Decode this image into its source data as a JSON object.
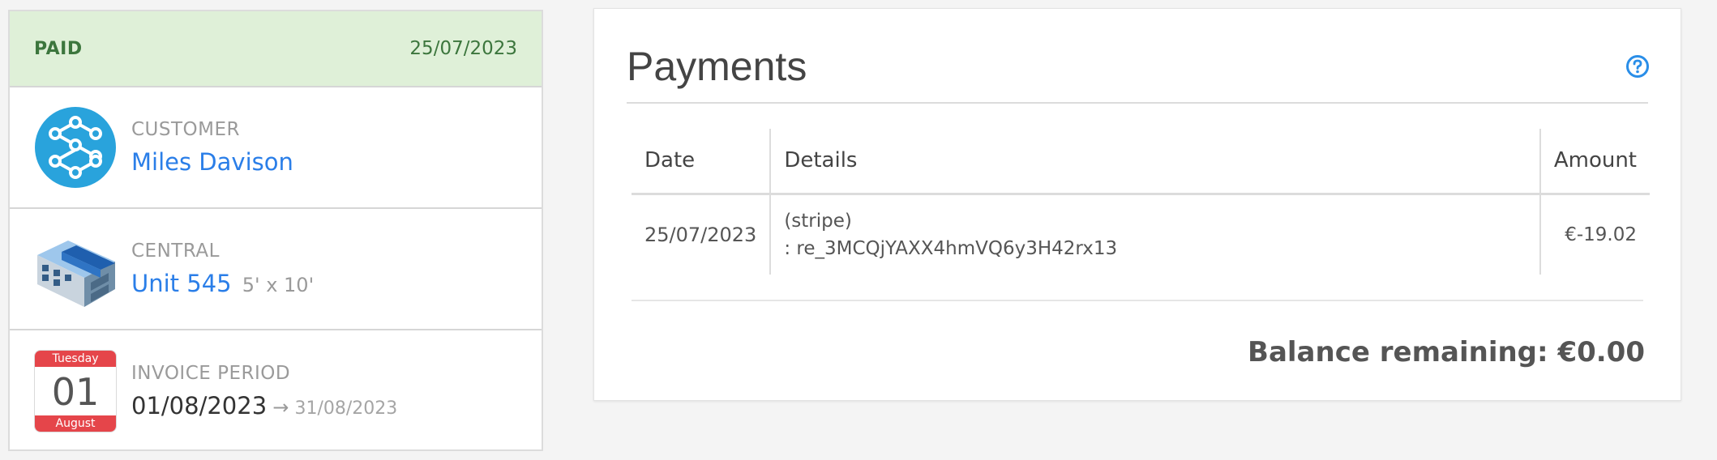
{
  "invoice": {
    "status": "PAID",
    "status_date": "25/07/2023",
    "customer": {
      "label": "CUSTOMER",
      "name": "Miles Davison",
      "icon": "customer-avatar-icon"
    },
    "site": {
      "label": "CENTRAL",
      "unit": "Unit 545",
      "size": "5' x 10'",
      "icon": "building-icon"
    },
    "period": {
      "label": "INVOICE PERIOD",
      "start": "01/08/2023",
      "arrow": "→",
      "end": "31/08/2023",
      "calendar": {
        "weekday": "Tuesday",
        "day": "01",
        "month": "August"
      }
    }
  },
  "payments": {
    "title": "Payments",
    "help_icon": "question-circle-icon",
    "columns": {
      "date": "Date",
      "details": "Details",
      "amount": "Amount"
    },
    "rows": [
      {
        "date": "25/07/2023",
        "details_line1": "(stripe)",
        "details_line2": ": re_3MCQjYAXX4hmVQ6y3H42rx13",
        "amount": "€-19.02"
      }
    ],
    "balance": "Balance remaining: €0.00"
  },
  "colors": {
    "paid_bg": "#dff0d8",
    "paid_text": "#3c763d",
    "link": "#2a7ee8",
    "calendar_red": "#e5454a",
    "avatar_blue": "#29a3dc"
  }
}
